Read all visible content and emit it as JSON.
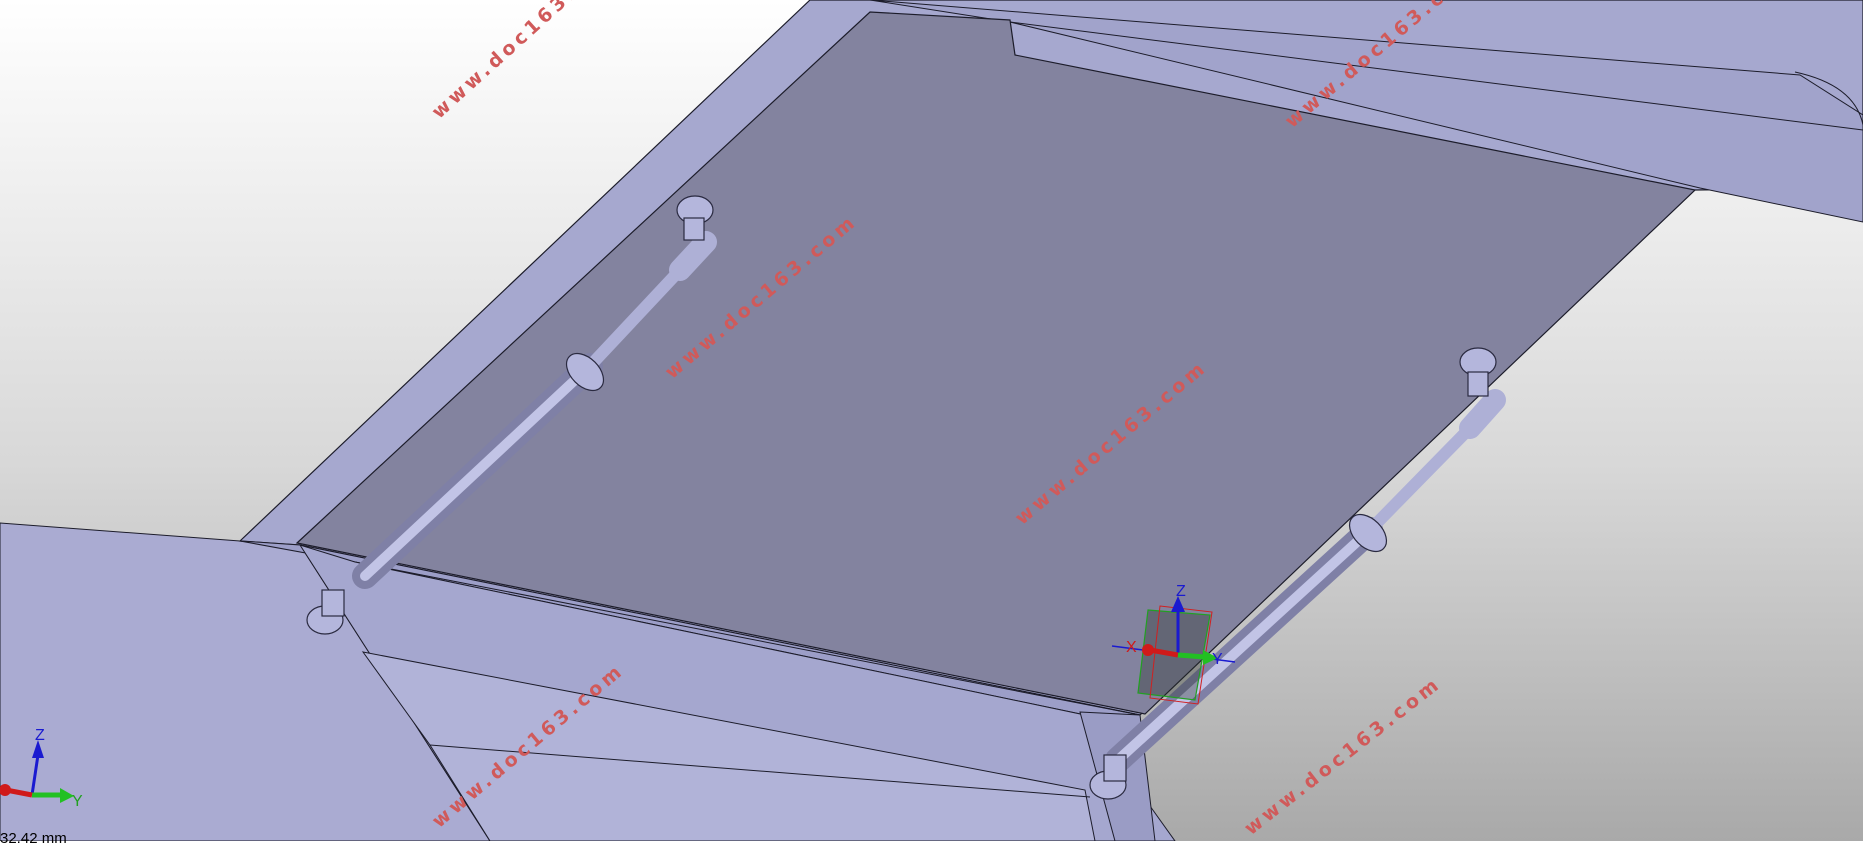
{
  "viewport": {
    "name": "3D CAD model viewport",
    "background_top_color": "#ffffff",
    "background_bottom_color": "#a9a9a9",
    "part_face_color": "#a7a9cf",
    "part_dark_face_color": "#82829f"
  },
  "watermark": {
    "text": "www.doc163.com",
    "color": "#d05a5a"
  },
  "triad": {
    "z_label": "Z",
    "y_label": "Y",
    "x_label": "X",
    "z_color": "#1a1ad0",
    "y_color": "#22c022",
    "x_color": "#d01a1a"
  },
  "scale": {
    "readout": "32.42 mm"
  }
}
